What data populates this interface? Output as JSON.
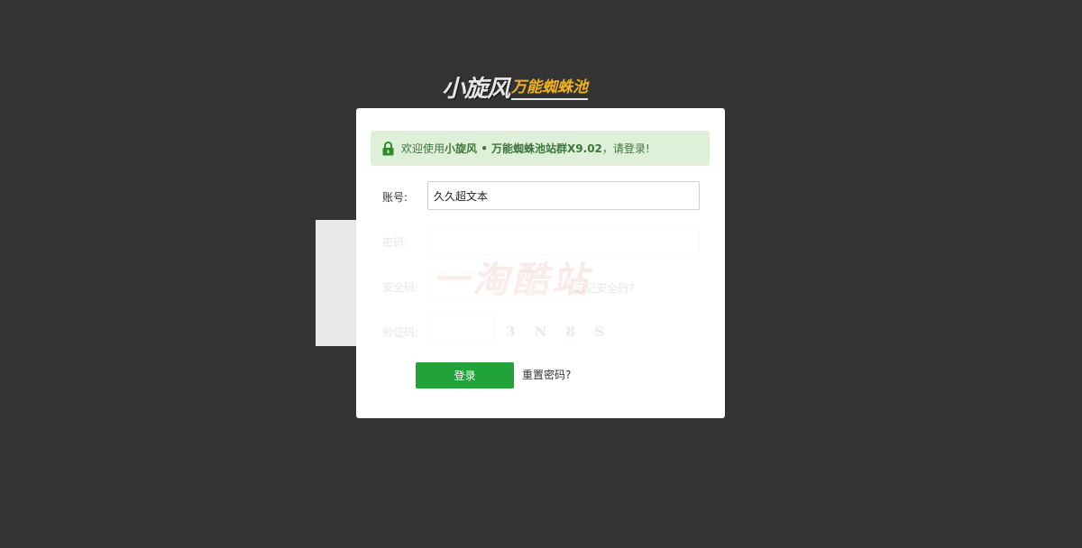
{
  "logo": {
    "main": "小旋风",
    "sub": "万能蜘蛛池"
  },
  "notice": {
    "prefix": "欢迎使用",
    "product": "小旋风 • 万能蜘蛛池站群X9.02",
    "suffix": "，请登录!"
  },
  "form": {
    "account_label": "账号:",
    "account_value": "久久超文本",
    "password_label": "密码:",
    "password_value": "",
    "security_label": "安全码:",
    "security_value": "",
    "forgot_security": "忘记安全码?",
    "captcha_label": "验证码:",
    "captcha_value": "",
    "captcha_image_text": "3 N 8 S"
  },
  "watermark": "一淘酷站",
  "actions": {
    "login": "登录",
    "reset_password": "重置密码?"
  },
  "colors": {
    "background": "#333333",
    "accent_green": "#22a33a",
    "notice_bg": "#dff0d8",
    "logo_gold": "#f0b21e"
  }
}
